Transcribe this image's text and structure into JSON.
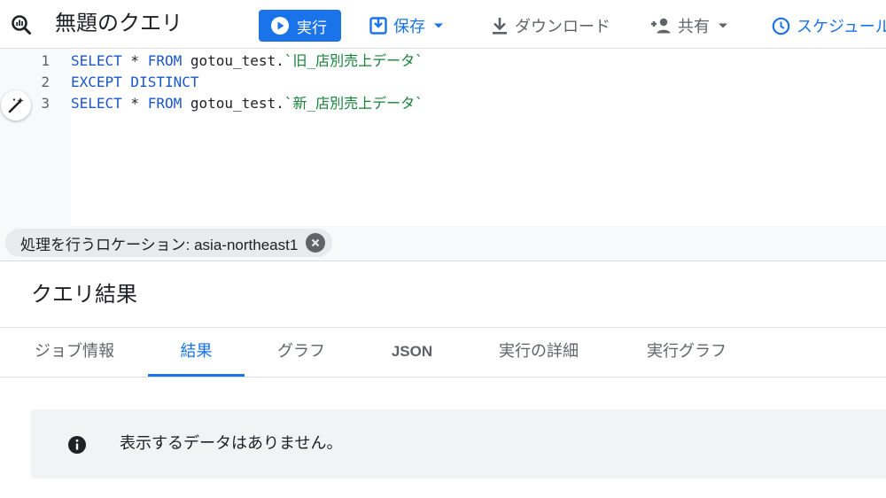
{
  "toolbar": {
    "title": "無題のクエリ",
    "run_label": "実行",
    "save_label": "保存",
    "download_label": "ダウンロード",
    "share_label": "共有",
    "schedule_label": "スケジュール"
  },
  "editor": {
    "lines": [
      {
        "number": "1",
        "keyword1": "SELECT",
        "star": " * ",
        "keyword2": "FROM",
        "plain": " gotou_test.",
        "table": "`旧_店別売上データ`"
      },
      {
        "number": "2",
        "keyword1": "EXCEPT DISTINCT"
      },
      {
        "number": "3",
        "keyword1": "SELECT",
        "star": " * ",
        "keyword2": "FROM",
        "plain": " gotou_test.",
        "table": "`新_店別売上データ`"
      }
    ]
  },
  "location_chip": {
    "label": "処理を行うロケーション: asia-northeast1"
  },
  "results": {
    "title": "クエリ結果",
    "tabs": [
      {
        "label": "ジョブ情報"
      },
      {
        "label": "結果"
      },
      {
        "label": "グラフ"
      },
      {
        "label": "JSON"
      },
      {
        "label": "実行の詳細"
      },
      {
        "label": "実行グラフ"
      }
    ],
    "active_tab": "結果",
    "empty_message": "表示するデータはありません。"
  },
  "colors": {
    "accent": "#1a73e8",
    "keyword": "#1a56c9",
    "string": "#188038"
  }
}
